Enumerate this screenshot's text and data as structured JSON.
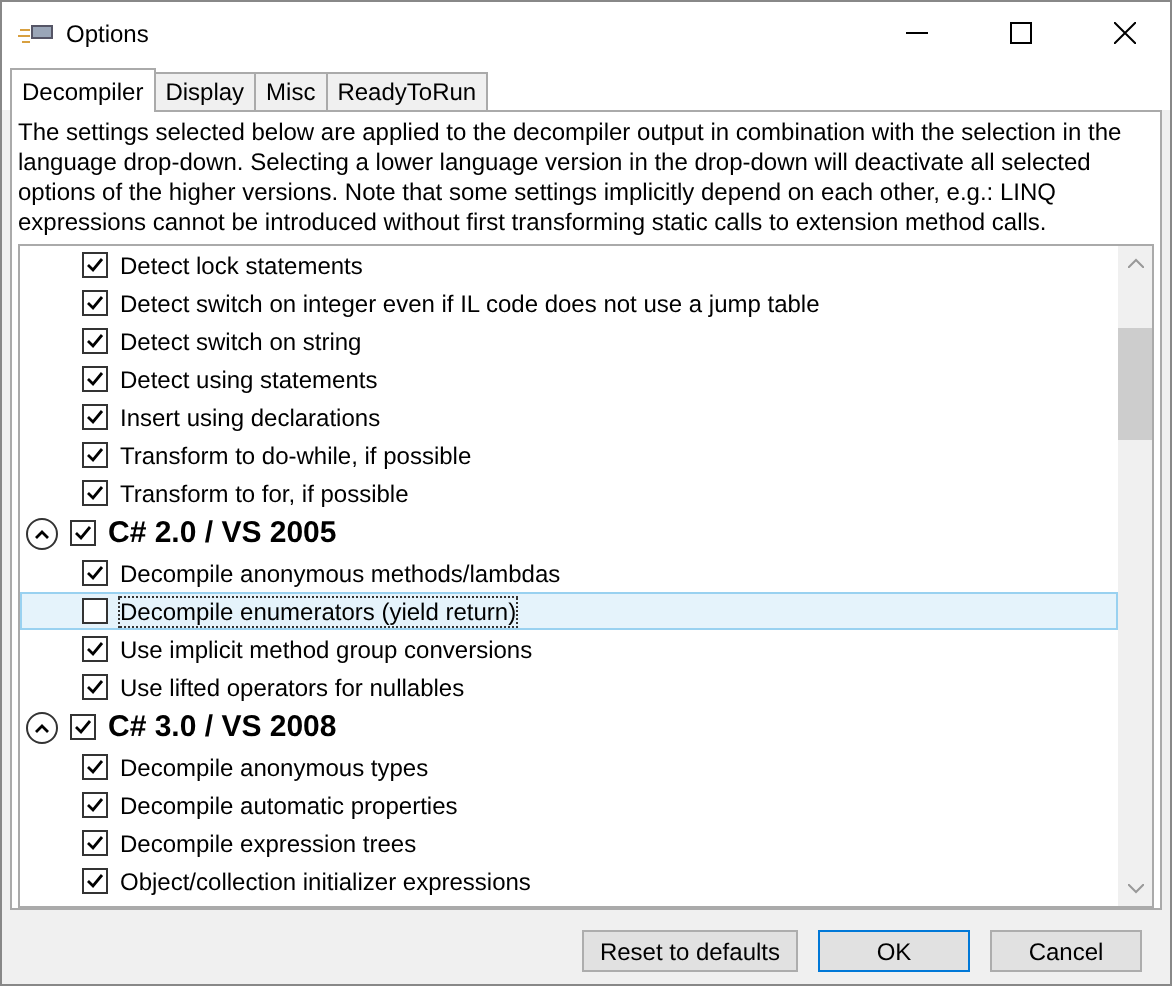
{
  "window": {
    "title": "Options"
  },
  "tabs": [
    {
      "label": "Decompiler",
      "selected": true
    },
    {
      "label": "Display",
      "selected": false
    },
    {
      "label": "Misc",
      "selected": false
    },
    {
      "label": "ReadyToRun",
      "selected": false
    }
  ],
  "description": "The settings selected below are applied to the decompiler output in combination with the selection in the language drop-down. Selecting a lower language version in the drop-down will deactivate all selected options of the higher versions. Note that some settings implicitly depend on each other, e.g.: LINQ expressions cannot be introduced without first transforming static calls to extension method calls.",
  "options": [
    {
      "kind": "option",
      "label": "Detect lock statements",
      "checked": true,
      "selected": false
    },
    {
      "kind": "option",
      "label": "Detect switch on integer even if IL code does not use a jump table",
      "checked": true,
      "selected": false
    },
    {
      "kind": "option",
      "label": "Detect switch on string",
      "checked": true,
      "selected": false
    },
    {
      "kind": "option",
      "label": "Detect using statements",
      "checked": true,
      "selected": false
    },
    {
      "kind": "option",
      "label": "Insert using declarations",
      "checked": true,
      "selected": false
    },
    {
      "kind": "option",
      "label": "Transform to do-while, if possible",
      "checked": true,
      "selected": false
    },
    {
      "kind": "option",
      "label": "Transform to for, if possible",
      "checked": true,
      "selected": false
    },
    {
      "kind": "group",
      "label": "C# 2.0 / VS 2005",
      "checked": true,
      "expanded": true,
      "selected": false
    },
    {
      "kind": "option",
      "label": "Decompile anonymous methods/lambdas",
      "checked": true,
      "selected": false
    },
    {
      "kind": "option",
      "label": "Decompile enumerators (yield return)",
      "checked": false,
      "selected": true
    },
    {
      "kind": "option",
      "label": "Use implicit method group conversions",
      "checked": true,
      "selected": false
    },
    {
      "kind": "option",
      "label": "Use lifted operators for nullables",
      "checked": true,
      "selected": false
    },
    {
      "kind": "group",
      "label": "C# 3.0 / VS 2008",
      "checked": true,
      "expanded": true,
      "selected": false
    },
    {
      "kind": "option",
      "label": "Decompile anonymous types",
      "checked": true,
      "selected": false
    },
    {
      "kind": "option",
      "label": "Decompile automatic properties",
      "checked": true,
      "selected": false
    },
    {
      "kind": "option",
      "label": "Decompile expression trees",
      "checked": true,
      "selected": false
    },
    {
      "kind": "option",
      "label": "Object/collection initializer expressions",
      "checked": true,
      "selected": false
    }
  ],
  "buttons": [
    {
      "label": "Reset to defaults",
      "selected": false
    },
    {
      "label": "OK",
      "selected": true
    },
    {
      "label": "Cancel",
      "selected": false
    }
  ]
}
